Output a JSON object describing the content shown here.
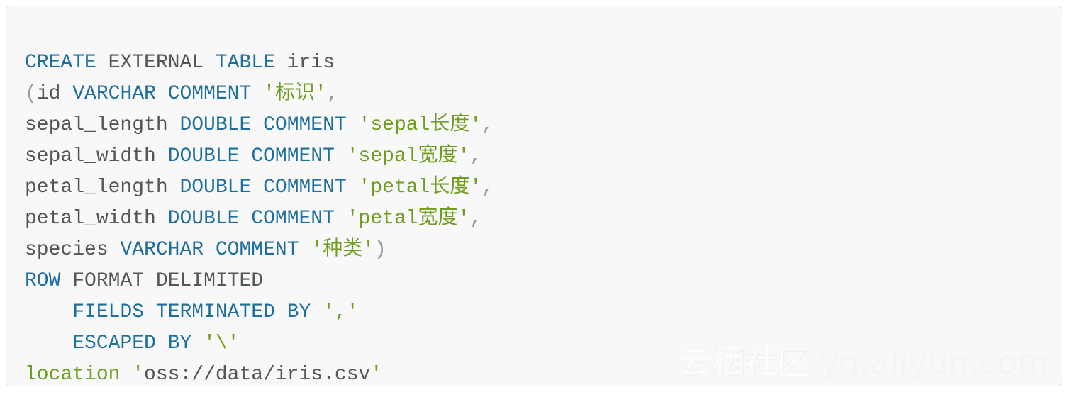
{
  "card": {
    "background_color": "#f8f8f8",
    "border_color": "#e6e6e6",
    "language": "sql"
  },
  "theme": {
    "keyword_color": "#1f6f9e",
    "string_color": "#6f9d1f",
    "identifier_color": "#555555",
    "punctuation_color": "#8d9ba3",
    "function_color": "#6f9d1f"
  },
  "code": {
    "lines": [
      {
        "indent": "",
        "tokens": [
          {
            "t": "CREATE",
            "k": "kw"
          },
          {
            "t": " ",
            "k": "plain"
          },
          {
            "t": "EXTERNAL",
            "k": "id"
          },
          {
            "t": " ",
            "k": "plain"
          },
          {
            "t": "TABLE",
            "k": "kw"
          },
          {
            "t": " ",
            "k": "plain"
          },
          {
            "t": "iris",
            "k": "id"
          }
        ]
      },
      {
        "indent": "",
        "tokens": [
          {
            "t": "(",
            "k": "punc"
          },
          {
            "t": "id",
            "k": "id"
          },
          {
            "t": " ",
            "k": "plain"
          },
          {
            "t": "VARCHAR",
            "k": "kw"
          },
          {
            "t": " ",
            "k": "plain"
          },
          {
            "t": "COMMENT",
            "k": "kw"
          },
          {
            "t": " ",
            "k": "plain"
          },
          {
            "t": "'标识'",
            "k": "str"
          },
          {
            "t": ",",
            "k": "punc"
          }
        ]
      },
      {
        "indent": "",
        "tokens": [
          {
            "t": "sepal_length",
            "k": "id"
          },
          {
            "t": " ",
            "k": "plain"
          },
          {
            "t": "DOUBLE",
            "k": "kw"
          },
          {
            "t": " ",
            "k": "plain"
          },
          {
            "t": "COMMENT",
            "k": "kw"
          },
          {
            "t": " ",
            "k": "plain"
          },
          {
            "t": "'sepal长度'",
            "k": "str"
          },
          {
            "t": ",",
            "k": "punc"
          }
        ]
      },
      {
        "indent": "",
        "tokens": [
          {
            "t": "sepal_width",
            "k": "id"
          },
          {
            "t": " ",
            "k": "plain"
          },
          {
            "t": "DOUBLE",
            "k": "kw"
          },
          {
            "t": " ",
            "k": "plain"
          },
          {
            "t": "COMMENT",
            "k": "kw"
          },
          {
            "t": " ",
            "k": "plain"
          },
          {
            "t": "'sepal宽度'",
            "k": "str"
          },
          {
            "t": ",",
            "k": "punc"
          }
        ]
      },
      {
        "indent": "",
        "tokens": [
          {
            "t": "petal_length",
            "k": "id"
          },
          {
            "t": " ",
            "k": "plain"
          },
          {
            "t": "DOUBLE",
            "k": "kw"
          },
          {
            "t": " ",
            "k": "plain"
          },
          {
            "t": "COMMENT",
            "k": "kw"
          },
          {
            "t": " ",
            "k": "plain"
          },
          {
            "t": "'petal长度'",
            "k": "str"
          },
          {
            "t": ",",
            "k": "punc"
          }
        ]
      },
      {
        "indent": "",
        "tokens": [
          {
            "t": "petal_width",
            "k": "id"
          },
          {
            "t": " ",
            "k": "plain"
          },
          {
            "t": "DOUBLE",
            "k": "kw"
          },
          {
            "t": " ",
            "k": "plain"
          },
          {
            "t": "COMMENT",
            "k": "kw"
          },
          {
            "t": " ",
            "k": "plain"
          },
          {
            "t": "'petal宽度'",
            "k": "str"
          },
          {
            "t": ",",
            "k": "punc"
          }
        ]
      },
      {
        "indent": "",
        "tokens": [
          {
            "t": "species",
            "k": "id"
          },
          {
            "t": " ",
            "k": "plain"
          },
          {
            "t": "VARCHAR",
            "k": "kw"
          },
          {
            "t": " ",
            "k": "plain"
          },
          {
            "t": "COMMENT",
            "k": "kw"
          },
          {
            "t": " ",
            "k": "plain"
          },
          {
            "t": "'种类'",
            "k": "str"
          },
          {
            "t": ")",
            "k": "punc"
          }
        ]
      },
      {
        "indent": "",
        "tokens": [
          {
            "t": "ROW",
            "k": "kw"
          },
          {
            "t": " ",
            "k": "plain"
          },
          {
            "t": "FORMAT",
            "k": "id"
          },
          {
            "t": " ",
            "k": "plain"
          },
          {
            "t": "DELIMITED",
            "k": "id"
          }
        ]
      },
      {
        "indent": "    ",
        "tokens": [
          {
            "t": "FIELDS",
            "k": "kw"
          },
          {
            "t": " ",
            "k": "plain"
          },
          {
            "t": "TERMINATED",
            "k": "kw"
          },
          {
            "t": " ",
            "k": "plain"
          },
          {
            "t": "BY",
            "k": "kw"
          },
          {
            "t": " ",
            "k": "plain"
          },
          {
            "t": "','",
            "k": "str"
          }
        ]
      },
      {
        "indent": "    ",
        "tokens": [
          {
            "t": "ESCAPED",
            "k": "kw"
          },
          {
            "t": " ",
            "k": "plain"
          },
          {
            "t": "BY",
            "k": "kw"
          },
          {
            "t": " ",
            "k": "plain"
          },
          {
            "t": "'\\'",
            "k": "str"
          }
        ]
      },
      {
        "indent": "",
        "tokens": [
          {
            "t": "location",
            "k": "name"
          },
          {
            "t": " ",
            "k": "plain"
          },
          {
            "t": "'",
            "k": "str"
          },
          {
            "t": "oss://data/iris.csv",
            "k": "id"
          },
          {
            "t": "'",
            "k": "str"
          }
        ]
      }
    ],
    "plain_text": "CREATE EXTERNAL TABLE iris\n(id VARCHAR COMMENT '标识',\nsepal_length DOUBLE COMMENT 'sepal长度',\nsepal_width DOUBLE COMMENT 'sepal宽度',\npetal_length DOUBLE COMMENT 'petal长度',\npetal_width DOUBLE COMMENT 'petal宽度',\nspecies VARCHAR COMMENT '种类')\nROW FORMAT DELIMITED\n    FIELDS TERMINATED BY ','\n    ESCAPED BY '\\'\nlocation 'oss://data/iris.csv'"
  },
  "watermark": {
    "brand": "云栖社区",
    "url": "yq.aliyun.com"
  }
}
